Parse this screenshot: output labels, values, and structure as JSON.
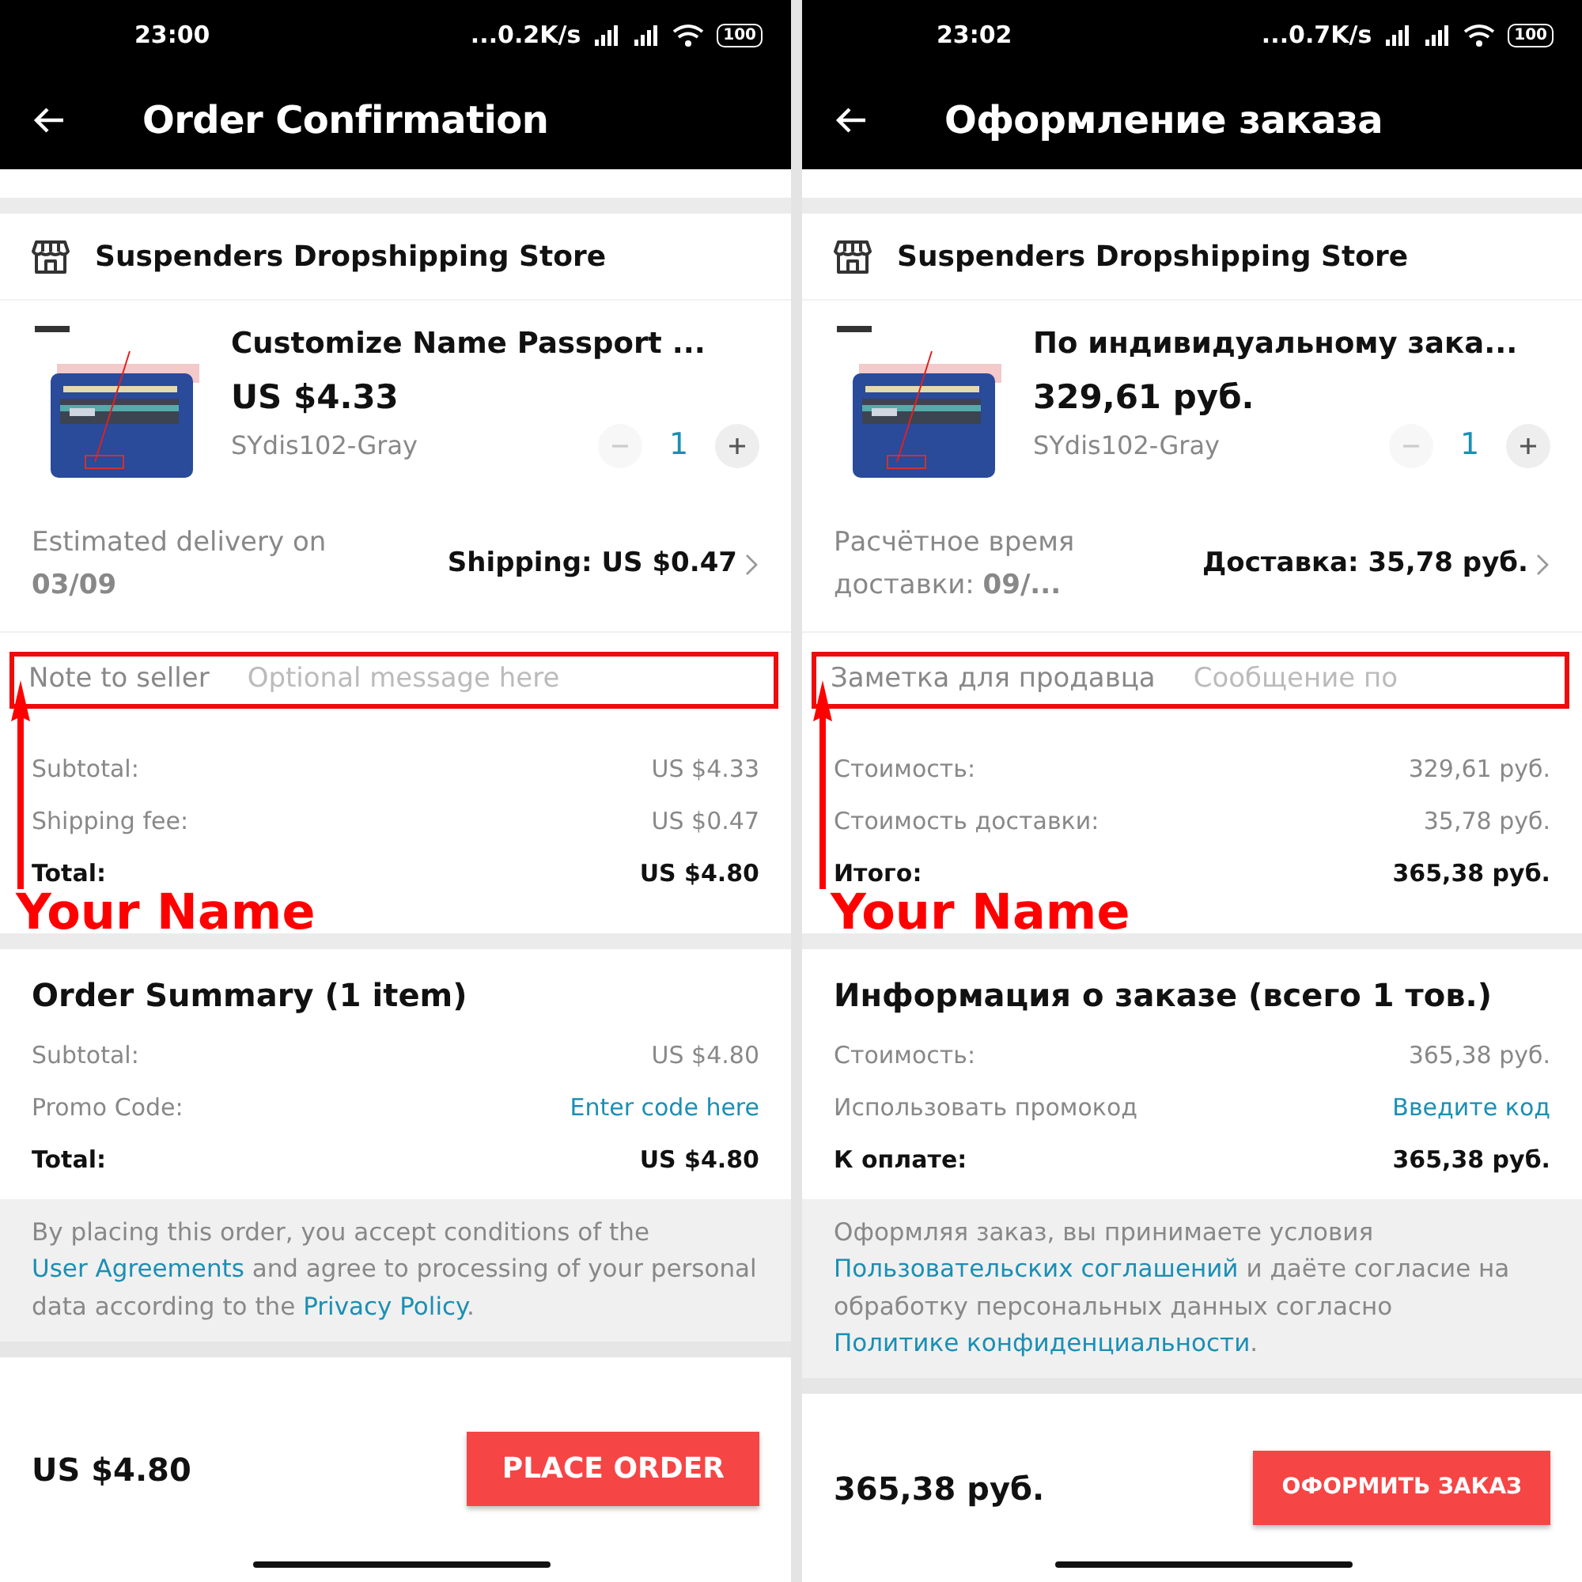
{
  "screens": [
    {
      "status_bar": {
        "time": "23:00",
        "net_speed": "...0.2K/s",
        "battery": "100"
      },
      "title": "Order Confirmation",
      "store": {
        "name": "Suspenders Dropshipping Store"
      },
      "product": {
        "kind": "picture",
        "title": "Customize Name Passport ...",
        "price": "US $4.33",
        "sku": "SYdis102-Gray",
        "quantity": "1",
        "decrease_disabled": true
      },
      "delivery": {
        "estimate": "Estimated delivery on **03/09**",
        "shipping": "Shipping: US $0.47"
      },
      "note": {
        "label": "Note to seller",
        "placeholder": "Optional message here"
      },
      "costs": [
        {
          "kind": "plain",
          "label": "Subtotal:",
          "value": "US $4.33"
        },
        {
          "kind": "plain",
          "label": "Shipping fee:",
          "value": "US $0.47"
        },
        {
          "kind": "total",
          "label": "Total:",
          "value": "US $4.80"
        }
      ],
      "annotation": {
        "label": "Your Name"
      },
      "summary": {
        "title": "Order Summary (1 item)",
        "rows": [
          {
            "kind": "plain",
            "label": "Subtotal:",
            "value": "US $4.80"
          },
          {
            "kind": "link",
            "label": "Promo Code:",
            "value": "Enter code here"
          },
          {
            "kind": "total",
            "label": "Total:",
            "value": "US $4.80"
          }
        ]
      },
      "legal": [
        {
          "text": "By placing this order, you accept conditions of the ",
          "link": false
        },
        {
          "text": "User Agreements",
          "link": true
        },
        {
          "text": " and agree to processing of your personal data according to the ",
          "link": false
        },
        {
          "text": "Privacy Policy",
          "link": true
        },
        {
          "text": ".",
          "link": false
        }
      ],
      "footer": {
        "total": "US $4.80",
        "button": "PLACE ORDER"
      }
    },
    {
      "status_bar": {
        "time": "23:02",
        "net_speed": "...0.7K/s",
        "battery": "100"
      },
      "title": "Оформление заказа",
      "store": {
        "name": "Suspenders Dropshipping Store"
      },
      "product": {
        "kind": "picture",
        "title": "По индивидуальному зака...",
        "price": "329,61 руб.",
        "sku": "SYdis102-Gray",
        "quantity": "1",
        "decrease_disabled": true
      },
      "delivery": {
        "estimate": "Расчётное время доставки: **09/...**",
        "shipping": "Доставка: 35,78 руб."
      },
      "note": {
        "label": "Заметка для продавца",
        "placeholder": "Сообщение по"
      },
      "costs": [
        {
          "kind": "plain",
          "label": "Стоимость:",
          "value": "329,61 руб."
        },
        {
          "kind": "plain",
          "label": "Стоимость доставки:",
          "value": "35,78 руб."
        },
        {
          "kind": "total",
          "label": "Итого:",
          "value": "365,38 руб."
        }
      ],
      "annotation": {
        "label": "Your Name"
      },
      "summary": {
        "title": "Информация о заказе (всего 1 тов.)",
        "rows": [
          {
            "kind": "plain",
            "label": "Стоимость:",
            "value": "365,38 руб."
          },
          {
            "kind": "link",
            "label": "Использовать промокод",
            "value": "Введите код"
          },
          {
            "kind": "total",
            "label": "К оплате:",
            "value": "365,38 руб."
          }
        ]
      },
      "legal": [
        {
          "text": "Оформляя заказ, вы принимаете условия ",
          "link": false
        },
        {
          "text": "Пользовательских соглашений",
          "link": true
        },
        {
          "text": " и даёте согласие на обработку персональных данных согласно ",
          "link": false
        },
        {
          "text": "Политике конфиденциальности",
          "link": true
        },
        {
          "text": ".",
          "link": false
        }
      ],
      "footer": {
        "total": "365,38 руб.",
        "button": "ОФОРМИТЬ ЗАКАЗ"
      }
    }
  ]
}
